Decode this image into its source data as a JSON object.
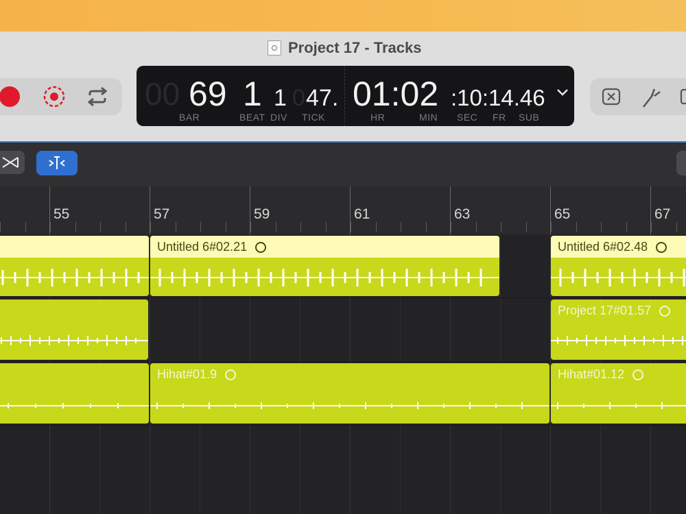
{
  "window": {
    "title": "Project 17 - Tracks"
  },
  "lcd": {
    "bar_dim": "00",
    "bar": "69",
    "beat": "1",
    "div": "1",
    "tick_dim": "0",
    "tick": "47.",
    "hr_min": "01:02",
    "sec_fr": ":10:14.46",
    "labels": {
      "bar": "BAR",
      "beat": "BEAT",
      "div": "DIV",
      "tick": "TICK",
      "hr": "HR",
      "min": "MIN",
      "sec": "SEC",
      "fr": "FR",
      "sub": "SUB"
    }
  },
  "controls": {
    "record": {
      "icon": "record-icon",
      "color": "#e01a2b"
    },
    "capture": {
      "icon": "capture-record-icon"
    },
    "cycle": {
      "icon": "cycle-icon"
    },
    "lcd_menu": {
      "icon": "chevron-down-icon"
    },
    "right": [
      {
        "icon": "x-box-icon"
      },
      {
        "icon": "tuner-icon"
      }
    ]
  },
  "edit_toolbar": {
    "crossfade_icon": "crossfade-icon",
    "snap_icon": "snap-icon",
    "snap_active": true,
    "accent": "#2f6fd0"
  },
  "ruler": {
    "bars": [
      "55",
      "57",
      "59",
      "61",
      "63",
      "65",
      "67"
    ]
  },
  "tracks": [
    {
      "regions": [
        {
          "name": "",
          "style": "light"
        },
        {
          "name": "Untitled 6#02.21",
          "style": "light"
        },
        {
          "name": "Untitled 6#02.48",
          "style": "light"
        }
      ]
    },
    {
      "regions": [
        {
          "name": "",
          "style": "selected"
        },
        {
          "name": "Project 17#01.57",
          "style": "selected"
        }
      ]
    },
    {
      "regions": [
        {
          "name": "",
          "style": "selected"
        },
        {
          "name": "Hihat#01.9",
          "style": "selected"
        },
        {
          "name": "Hihat#01.12",
          "style": "selected"
        }
      ]
    }
  ],
  "colors": {
    "region_fill": "#c8d81a",
    "region_header": "#fdfbb6",
    "selection": "#3d7fd8"
  }
}
